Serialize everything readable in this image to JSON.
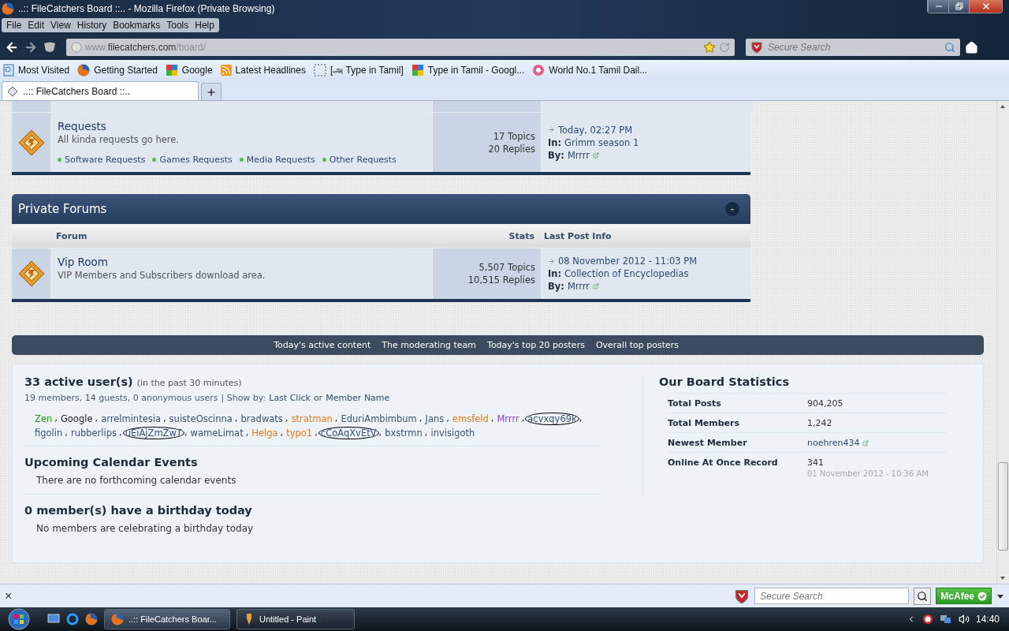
{
  "window": {
    "title": "..:: FileCatchers Board ::.. - Mozilla Firefox (Private Browsing)"
  },
  "menu": [
    "File",
    "Edit",
    "View",
    "History",
    "Bookmarks",
    "Tools",
    "Help"
  ],
  "address_bar": {
    "prefix": "www.",
    "domain": "filecatchers.com",
    "path": "/board/"
  },
  "search_bar": {
    "placeholder": "Secure Search"
  },
  "bookmarks": [
    {
      "label": "Most Visited",
      "kind": "folder"
    },
    {
      "label": "Getting Started",
      "kind": "browser"
    },
    {
      "label": "Google",
      "kind": "google"
    },
    {
      "label": "Latest Headlines",
      "kind": "feed"
    },
    {
      "label": "[அ Type in Tamil]",
      "kind": "blank"
    },
    {
      "label": "Type in Tamil - Googl...",
      "kind": "google"
    },
    {
      "label": "World No.1 Tamil Dail...",
      "kind": "site"
    }
  ],
  "tabs": [
    {
      "label": "..:: FileCatchers Board ::..",
      "selected": true
    }
  ],
  "forum_rows": [
    {
      "title": "Requests",
      "description": "All kinda requests go here.",
      "subforums": [
        "Software Requests",
        "Games Requests",
        "Media Requests",
        "Other Requests"
      ],
      "topics": "17 Topics",
      "replies": "20 Replies",
      "last_post": {
        "date": "Today, 02:27 PM",
        "in_label": "In:",
        "in": "Grimm season 1",
        "by_label": "By:",
        "by": "Mrrrr"
      }
    }
  ],
  "private_forums": {
    "title": "Private Forums",
    "toggle": "-",
    "columns": [
      "Forum",
      "Stats",
      "Last Post Info"
    ],
    "rows": [
      {
        "title": "Vip Room",
        "description": "VIP Members and Subscribers download area.",
        "subforums": [],
        "topics": "5,507 Topics",
        "replies": "10,515 Replies",
        "last_post": {
          "date": "08 November 2012 - 11:03 PM",
          "in_label": "In:",
          "in": "Collection of Encyclopedias",
          "by_label": "By:",
          "by": "Mrrrr"
        }
      }
    ]
  },
  "footer_links": [
    "Today's active content",
    "The moderating team",
    "Today's top 20 posters",
    "Overall top posters"
  ],
  "active_users": {
    "heading": "33 active user(s)",
    "note": "(in the past 30 minutes)",
    "summary": "19 members, 14 guests, 0 anonymous users",
    "show_by": "| Show by:",
    "sort_links": [
      "Last Click",
      "Member Name"
    ],
    "joiner": "or",
    "separator": ",",
    "users": [
      {
        "name": "Zen",
        "color": "#2a8a2a",
        "circled": false
      },
      {
        "name": "Google",
        "color": "#222222",
        "circled": false
      },
      {
        "name": "arrelmintesia",
        "color": "#3a5272",
        "circled": false
      },
      {
        "name": "suisteOscinna",
        "color": "#3a5272",
        "circled": false
      },
      {
        "name": "bradwats",
        "color": "#3a5272",
        "circled": false
      },
      {
        "name": "stratman",
        "color": "#e07b27",
        "circled": false
      },
      {
        "name": "EduriAmbimbum",
        "color": "#3a5272",
        "circled": false
      },
      {
        "name": "Jans",
        "color": "#3a5272",
        "circled": false
      },
      {
        "name": "emsfeld",
        "color": "#e07b27",
        "circled": false
      },
      {
        "name": "Mrrrr",
        "color": "#8a3fd1",
        "circled": false
      },
      {
        "name": "acvxqy69k",
        "color": "#3a5272",
        "circled": true
      },
      {
        "name": "figolin",
        "color": "#3a5272",
        "circled": false
      },
      {
        "name": "rubberlips",
        "color": "#3a5272",
        "circled": false
      },
      {
        "name": "uEiAjZmZwT",
        "color": "#3a5272",
        "circled": true
      },
      {
        "name": "wameLimat",
        "color": "#3a5272",
        "circled": false
      },
      {
        "name": "Helga",
        "color": "#e07b27",
        "circled": false
      },
      {
        "name": "typo1",
        "color": "#e07b27",
        "circled": false
      },
      {
        "name": "cCoAqXvEtV",
        "color": "#3a5272",
        "circled": true
      },
      {
        "name": "bxstrmn",
        "color": "#3a5272",
        "circled": false
      },
      {
        "name": "invisigoth",
        "color": "#3a5272",
        "circled": false
      }
    ]
  },
  "calendar": {
    "heading": "Upcoming Calendar Events",
    "text": "There are no forthcoming calendar events"
  },
  "birthdays": {
    "heading": "0 member(s) have a birthday today",
    "text": "No members are celebrating a birthday today"
  },
  "board_stats": {
    "heading": "Our Board Statistics",
    "rows": [
      {
        "label": "Total Posts",
        "value": "904,205",
        "kind": "plain"
      },
      {
        "label": "Total Members",
        "value": "1,242",
        "kind": "plain"
      },
      {
        "label": "Newest Member",
        "value": "noehren434",
        "kind": "link"
      },
      {
        "label": "Online At Once Record",
        "value": "341",
        "kind": "plain",
        "subtext": "01 November 2012 - 10:36 AM"
      }
    ]
  },
  "find_bar": {
    "close": "×",
    "placeholder": "Secure Search",
    "brand_button": "McAfee"
  },
  "taskbar": {
    "items": [
      {
        "label": "..:: FileCatchers Boar...",
        "kind": "browser",
        "selected": true
      },
      {
        "label": "Untitled - Paint",
        "kind": "paint",
        "selected": false
      }
    ],
    "clock": "14:40"
  }
}
